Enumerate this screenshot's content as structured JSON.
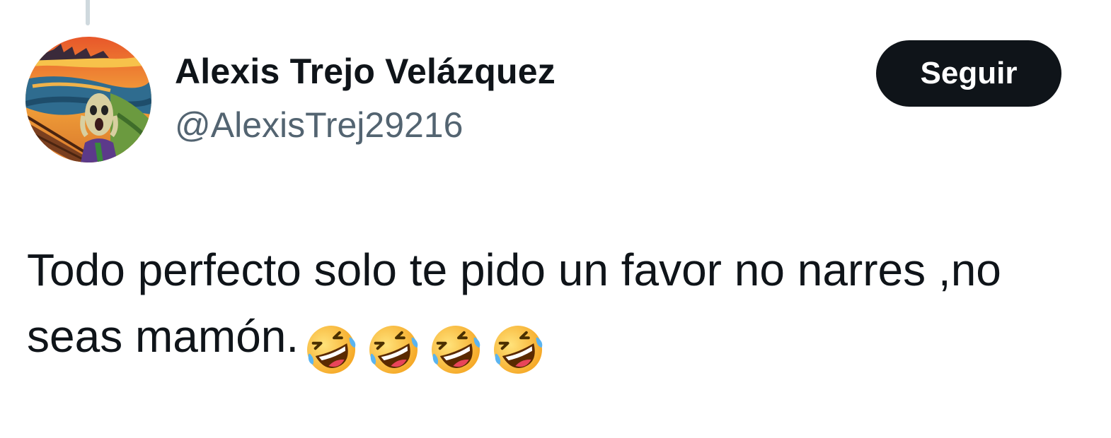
{
  "tweet": {
    "author": {
      "display_name": "Alexis Trejo Velázquez",
      "handle": "@AlexisTrej29216",
      "avatar_icon": "scream-painting-avatar"
    },
    "follow_label": "Seguir",
    "text_line1": "Todo perfecto solo te pido un favor no narres ,no",
    "text_line2": "seas mamón.",
    "emojis": [
      "🤣",
      "🤣",
      "🤣",
      "🤣"
    ],
    "emoji_name": "rolling-on-the-floor-laughing-icon"
  },
  "colors": {
    "text_primary": "#0f1419",
    "text_secondary": "#536471",
    "button_bg": "#0f1419",
    "button_text": "#ffffff",
    "thread_line": "#cfd9de"
  }
}
